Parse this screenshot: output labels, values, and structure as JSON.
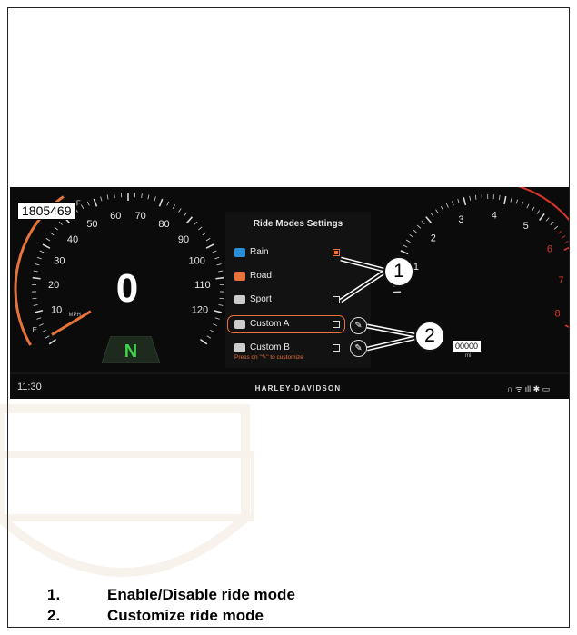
{
  "figure_id": "1805469",
  "speedometer": {
    "speed": "0",
    "gear": "N",
    "ticks": [
      "10",
      "20",
      "30",
      "40",
      "50",
      "60",
      "70",
      "80",
      "90",
      "100",
      "110",
      "120"
    ],
    "unit": "MPH",
    "fuel_full": "F",
    "fuel_empty": "E"
  },
  "tachometer": {
    "ticks": [
      "1",
      "2",
      "3",
      "4",
      "5",
      "6",
      "7",
      "8"
    ],
    "odometer": "00000",
    "odometer_unit": "mi"
  },
  "menu": {
    "title": "Ride Modes Settings",
    "modes": [
      {
        "label": "Rain",
        "icon": "rain-icon",
        "color": "#2a8fd6",
        "enabled": true
      },
      {
        "label": "Road",
        "icon": "road-icon",
        "color": "#e8733a",
        "enabled": null
      },
      {
        "label": "Sport",
        "icon": "sport-icon",
        "color": "#cccccc",
        "enabled": false
      },
      {
        "label": "Custom A",
        "icon": "custom-a-icon",
        "color": "#cccccc",
        "enabled": false,
        "selected": true
      },
      {
        "label": "Custom B",
        "icon": "custom-b-icon",
        "color": "#cccccc",
        "enabled": false
      }
    ],
    "hint": "Press on \"✎\" to customize"
  },
  "status_bar": {
    "time": "11:30",
    "brand": "HARLEY-DAVIDSON",
    "icons": "∩ ᯤ ıll ✱ ▭"
  },
  "callouts": [
    "1",
    "2"
  ],
  "legend": [
    {
      "num": "1.",
      "text": "Enable/Disable ride mode"
    },
    {
      "num": "2.",
      "text": "Customize ride mode"
    }
  ],
  "colors": {
    "accent": "#e8733a",
    "gear_green": "#3fd14a",
    "redline": "#d9352b",
    "background": "#0b0b0b"
  }
}
